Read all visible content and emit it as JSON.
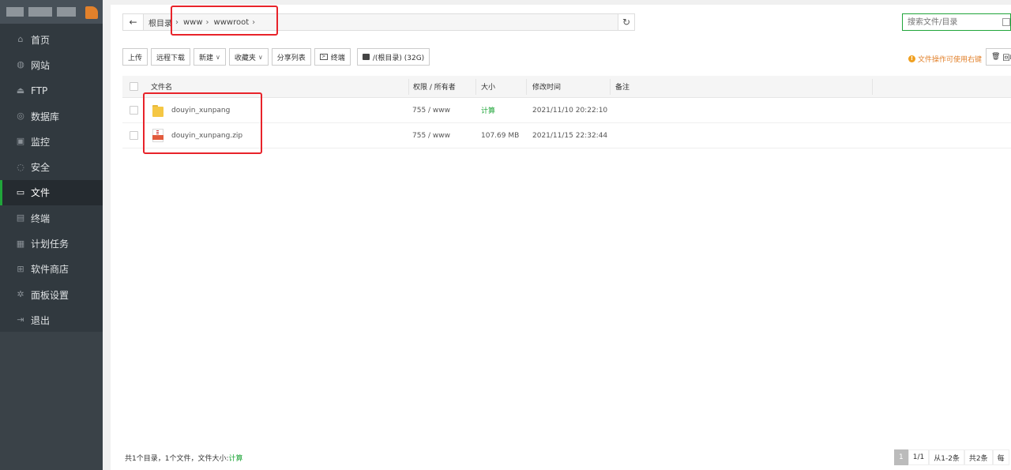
{
  "sidebar": {
    "items": [
      {
        "label": "首页",
        "icon": "home-icon",
        "glyph": "⌂"
      },
      {
        "label": "网站",
        "icon": "globe-icon",
        "glyph": "◍"
      },
      {
        "label": "FTP",
        "icon": "ftp-icon",
        "glyph": "⏏"
      },
      {
        "label": "数据库",
        "icon": "database-icon",
        "glyph": "◎"
      },
      {
        "label": "监控",
        "icon": "monitor-icon",
        "glyph": "▣"
      },
      {
        "label": "安全",
        "icon": "shield-icon",
        "glyph": "◌"
      },
      {
        "label": "文件",
        "icon": "folder-icon",
        "glyph": "▭",
        "active": true
      },
      {
        "label": "终端",
        "icon": "terminal-icon",
        "glyph": "▤"
      },
      {
        "label": "计划任务",
        "icon": "calendar-icon",
        "glyph": "▦"
      },
      {
        "label": "软件商店",
        "icon": "apps-icon",
        "glyph": "⊞"
      },
      {
        "label": "面板设置",
        "icon": "gear-icon",
        "glyph": "✲"
      },
      {
        "label": "退出",
        "icon": "logout-icon",
        "glyph": "⇥"
      }
    ]
  },
  "path": {
    "back_glyph": "←",
    "root": "根目录",
    "segments": [
      "www",
      "wwwroot"
    ],
    "separator": "›",
    "refresh_glyph": "↻"
  },
  "search": {
    "placeholder": "搜索文件/目录"
  },
  "toolbar": {
    "upload": "上传",
    "remote_download": "远程下载",
    "new": "新建",
    "favorites": "收藏夹",
    "share_list": "分享列表",
    "terminal": "终端",
    "disk": "/(根目录) (32G)",
    "dropdown_glyph": "∨"
  },
  "hint": {
    "icon": "info-icon",
    "text": "文件操作可使用右键"
  },
  "recycle": {
    "glyph": "🗑",
    "label": "回收站"
  },
  "table": {
    "headers": {
      "name": "文件名",
      "perm": "权限 / 所有者",
      "size": "大小",
      "mtime": "修改时间",
      "note": "备注"
    },
    "rows": [
      {
        "type": "folder",
        "name": "douyin_xunpang",
        "perm": "755 / www",
        "size": "计算",
        "mtime": "2021/11/10 20:22:10",
        "note": ""
      },
      {
        "type": "zip",
        "name": "douyin_xunpang.zip",
        "perm": "755 / www",
        "size": "107.69 MB",
        "mtime": "2021/11/15 22:32:44",
        "note": ""
      }
    ]
  },
  "summary": {
    "text": "共1个目录，1个文件，文件大小:",
    "link": "计算"
  },
  "pager": {
    "current": "1",
    "pages": "1/1",
    "range": "从1-2条",
    "total": "共2条",
    "per": "每"
  },
  "colors": {
    "accent": "#20a53a",
    "annotation": "#e8232a",
    "sidebar": "#31393f",
    "hint": "#e2812b"
  }
}
